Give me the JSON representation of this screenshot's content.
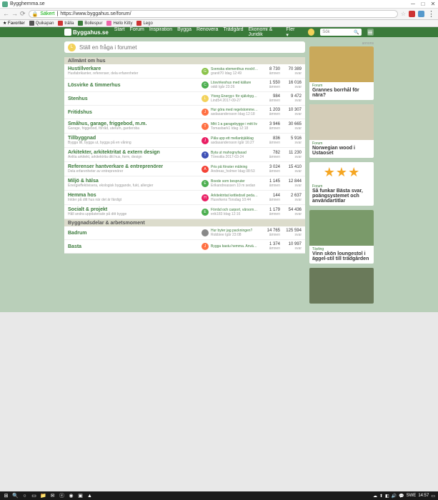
{
  "window": {
    "title": "Bygghemma.se"
  },
  "browser": {
    "secure_label": "Säkert",
    "url": "https://www.byggahus.se/forum/",
    "bookmarks_label": "Favoriter",
    "bookmarks": [
      {
        "label": "Quikapan",
        "color": "#555"
      },
      {
        "label": "trälla",
        "color": "#c33"
      },
      {
        "label": "Bollespur",
        "color": "#3a7a3a"
      },
      {
        "label": "Hello Kitty",
        "color": "#e6a"
      },
      {
        "label": "Lego",
        "color": "#c33"
      }
    ]
  },
  "header": {
    "logo": "Byggahus.se",
    "nav": [
      "Start",
      "Forum",
      "Inspiration",
      "Bygga",
      "Renovera",
      "Trädgård",
      "Ekonomi & Juridik",
      "Fler ▾"
    ],
    "search_placeholder": "Sök"
  },
  "ask": {
    "avatar": "L",
    "placeholder": "Ställ en fråga i forumet"
  },
  "categories": [
    {
      "title": "Allmänt om hus",
      "forums": [
        {
          "name": "Hustillverkare",
          "desc": "Husfabrikanter, referenser, dela erfarenheter",
          "last_title": "Svenska elementhus mockfj…",
          "last_meta": "granit70 Idag 12:49",
          "av": "G",
          "avc": "#8bc34a",
          "topics": "8 730",
          "replies": "70 389"
        },
        {
          "name": "Lösvirke & timmerhus",
          "desc": "",
          "last_title": "Lösvirkeshus med källare",
          "last_meta": "oddi Igår 23:26",
          "av": "C",
          "avc": "#4caf50",
          "topics": "1 550",
          "replies": "16 016"
        },
        {
          "name": "Stenhus",
          "desc": "",
          "last_title": "Ytong Energy+ för självbygg…",
          "last_meta": "Lind54 2017-09-27",
          "av": "L",
          "avc": "#f3d25a",
          "topics": "984",
          "replies": "9 472"
        },
        {
          "name": "Fritidshus",
          "desc": "",
          "last_title": "Hur göra med regelstomme s…",
          "last_meta": "asdasandersson Idag 12:18",
          "av": "J",
          "avc": "#ff7043",
          "topics": "1 203",
          "replies": "10 307"
        },
        {
          "name": "Småhus, garage, friggebod, m.m.",
          "desc": "Garage, friggebod, förråd, uterum, garderoba",
          "last_title": "Mitt 1:a garagebygge i mitt liv",
          "last_meta": "Tomasbark1 Idag 12:18",
          "av": "T",
          "avc": "#ff7043",
          "topics": "3 946",
          "replies": "30 665"
        },
        {
          "name": "Tillbyggnad",
          "desc": "Bygga till, bygga ut, bygga på en våning",
          "last_title": "Påla upp ett mellanbjälklag",
          "last_meta": "asdasandersson Igår 16:27",
          "av": "J",
          "avc": "#e91e63",
          "topics": "836",
          "replies": "5 916"
        },
        {
          "name": "Arkitekter, arkitektritat & extern design",
          "desc": "Anlita arkitekt, arkitektrita ditt hus, form, design",
          "last_title": "Byta ut mahognyfasad",
          "last_meta": "Törestila 2017-03-24",
          "av": "T",
          "avc": "#3f51b5",
          "topics": "782",
          "replies": "11 230"
        },
        {
          "name": "Referenser hantverkare & entreprenörer",
          "desc": "Dela erfarenheter av entreprenörer",
          "last_title": "Pris på fönster målning",
          "last_meta": "Andreas_holmer Idag 08:53",
          "av": "A",
          "avc": "#f44336",
          "topics": "3 024",
          "replies": "15 410"
        },
        {
          "name": "Miljö & hälsa",
          "desc": "Energieffektivisera, ekologisk byggande, fukt, allergier",
          "last_title": "Boede som bespruter",
          "last_meta": "Erikandreassen 10 m sedan",
          "av": "E",
          "avc": "#4caf50",
          "topics": "1 145",
          "replies": "12 844"
        },
        {
          "name": "Hemma hos",
          "desc": "Inlder på ditt hus när det är färdigt",
          "last_title": "Arkitektritat kettledsvil peda…",
          "last_meta": "Husvikens Torsdag 10:44",
          "av": "H",
          "avc": "#e91e63",
          "topics": "144",
          "replies": "2 637"
        },
        {
          "name": "Socialt & projekt",
          "desc": "Håll andra uppdaterade på ditt bygge",
          "last_title": "Förråd och carport, vårsom…",
          "last_meta": "erik183 Idag 12:16",
          "av": "E",
          "avc": "#4caf50",
          "topics": "1 179",
          "replies": "54 436"
        }
      ]
    },
    {
      "title": "Byggnadsdelar & arbetsmoment",
      "forums": [
        {
          "name": "Badrum",
          "desc": "",
          "last_title": "Hur byter jag packningen?",
          "last_meta": "Robbiee Igår 23:08",
          "av": "",
          "avc": "#888",
          "topics": "14 765",
          "replies": "125 594"
        },
        {
          "name": "Basta",
          "desc": "",
          "last_title": "Bygga bastu hemma. Använ…",
          "last_meta": "",
          "av": "J",
          "avc": "#ff7043",
          "topics": "1 374",
          "replies": "10 997"
        }
      ]
    }
  ],
  "sidebar": {
    "annons": "annons",
    "widgets": [
      {
        "img": "#c9a95b",
        "cat": "Forum",
        "title": "Grannes borrhål för nära?"
      },
      {
        "img": "#d4cdb8",
        "cat": "Forum",
        "title": "Norwegian wood i Ustaoset"
      },
      {
        "type": "stars",
        "cat": "Forum",
        "title": "Så funkar Bästa svar, poängsystemet och användartitlar"
      },
      {
        "img": "#7a9a6a",
        "cat": "Tävling",
        "title": "Vinn skön loungestol i äggel-stil till trädgården"
      },
      {
        "img": "#6a7a5a",
        "cat": "",
        "title": ""
      }
    ]
  },
  "taskbar": {
    "start": "Start",
    "lang": "SWE",
    "time": "14:57"
  }
}
